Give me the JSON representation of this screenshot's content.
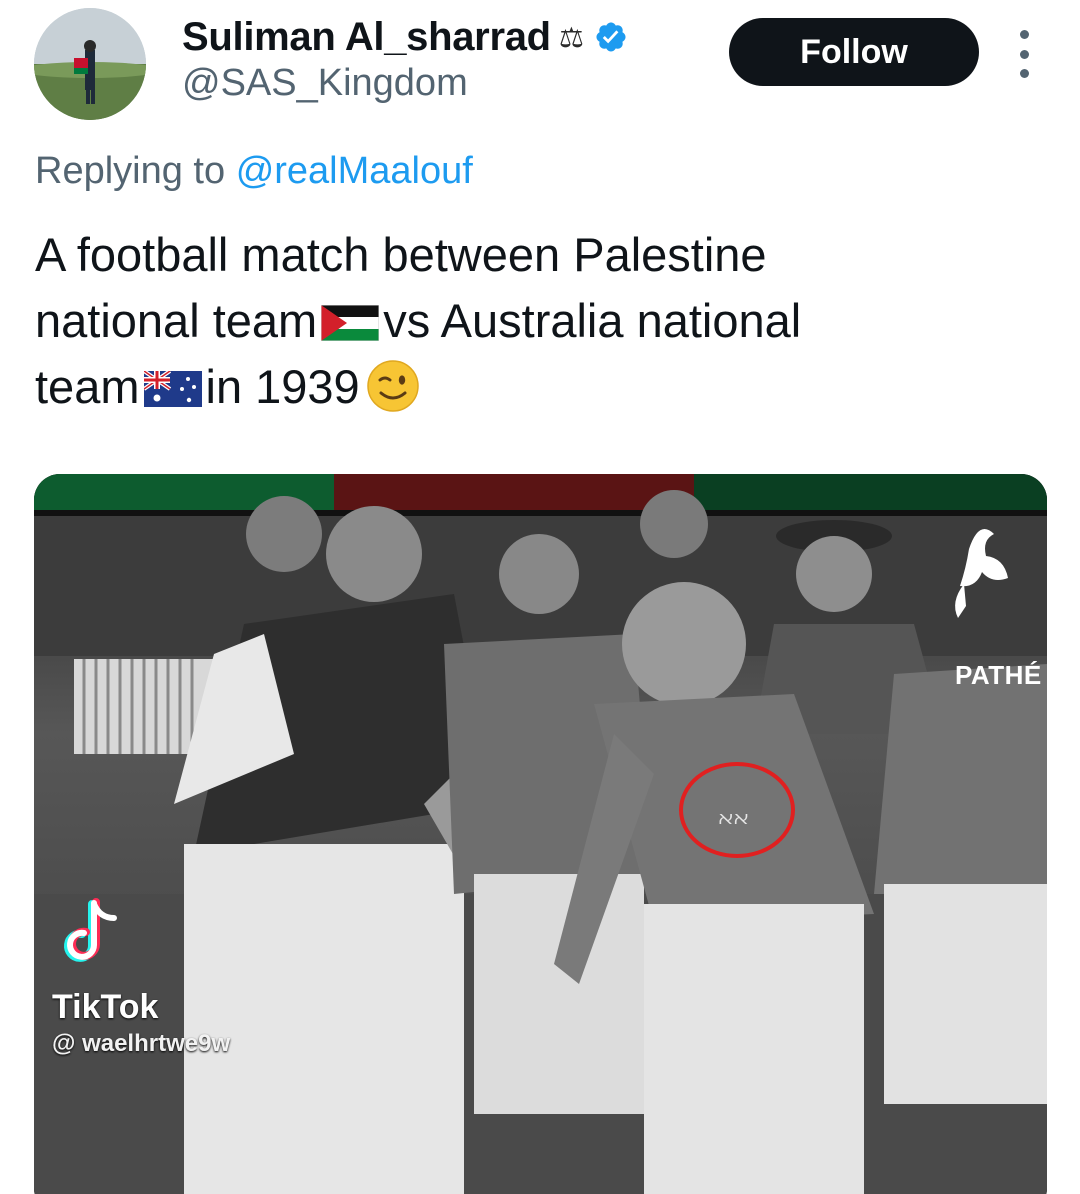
{
  "author": {
    "display_name": "Suliman Al_sharrad",
    "name_emoji": "⚖",
    "handle": "@SAS_Kingdom",
    "verified": true,
    "avatar_icon": "avatar-photo"
  },
  "actions": {
    "follow_label": "Follow",
    "more_icon": "more-vertical-icon"
  },
  "reply": {
    "prefix": "Replying to",
    "mention": "@realMaalouf"
  },
  "tweet": {
    "line1": "A football match between Palestine",
    "line2_a": "national team",
    "line2_b": "vs Australia national",
    "line3_a": "team",
    "line3_b": "in 1939",
    "flags": [
      "palestine-flag-icon",
      "australia-flag-icon"
    ],
    "end_emoji": "winking-face-icon"
  },
  "media": {
    "type": "video-thumbnail",
    "watermark_app": "TikTok",
    "watermark_user": "@ waelhrtwe9w",
    "broadcaster": "PATHÉ"
  },
  "colors": {
    "link": "#1d9bf0",
    "secondary_text": "#536471",
    "follow_bg": "#0f1419",
    "annotation_circle": "#e02020"
  }
}
